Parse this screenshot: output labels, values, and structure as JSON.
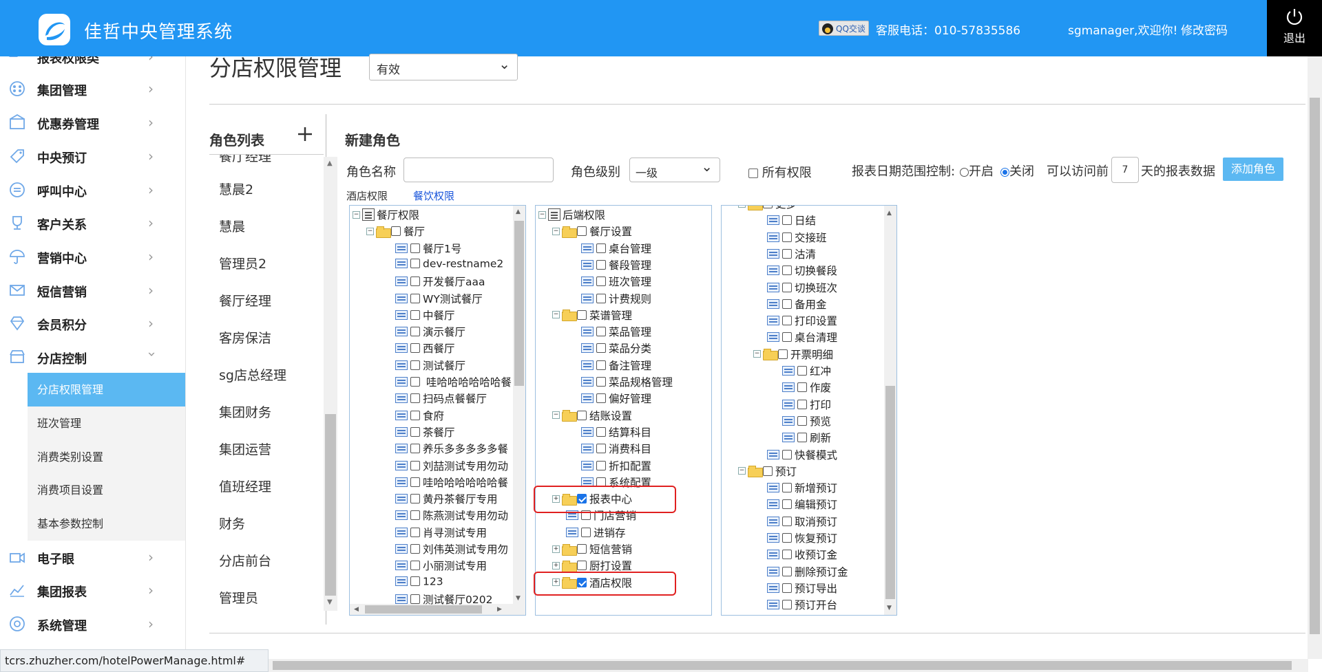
{
  "header": {
    "app_title": "佳哲中央管理系统",
    "qq_label": "QQ交谈",
    "service_phone": "客服电话：010-57835586",
    "welcome": "sgmanager,欢迎你!",
    "change_password": "修改密码",
    "logout": "退出",
    "brand_color": "#2196f3"
  },
  "sidebar": {
    "items": [
      {
        "label": "报表权限类",
        "icon": "report-icon"
      },
      {
        "label": "集团管理",
        "icon": "group-icon"
      },
      {
        "label": "优惠券管理",
        "icon": "coupon-icon"
      },
      {
        "label": "中央预订",
        "icon": "tag-icon"
      },
      {
        "label": "呼叫中心",
        "icon": "call-icon"
      },
      {
        "label": "客户关系",
        "icon": "trophy-icon"
      },
      {
        "label": "营销中心",
        "icon": "umbrella-icon"
      },
      {
        "label": "短信营销",
        "icon": "mail-icon"
      },
      {
        "label": "会员积分",
        "icon": "diamond-icon"
      },
      {
        "label": "分店控制",
        "icon": "store-icon"
      },
      {
        "label": "电子眼",
        "icon": "camera-icon"
      },
      {
        "label": "集团报表",
        "icon": "chart-icon"
      },
      {
        "label": "系统管理",
        "icon": "settings-icon"
      }
    ],
    "submenu": [
      {
        "label": "分店权限管理",
        "active": true
      },
      {
        "label": "班次管理"
      },
      {
        "label": "消费类别设置"
      },
      {
        "label": "消费项目设置"
      },
      {
        "label": "基本参数控制"
      }
    ]
  },
  "main": {
    "page_title": "分店权限管理",
    "status_value": "有效",
    "role_list_title": "角色列表",
    "roles": [
      "餐厅经理",
      "慧晨2",
      "慧晨",
      "管理员2",
      "餐厅经理",
      "客房保洁",
      "sg店总经理",
      "集团财务",
      "集团运营",
      "值班经理",
      "财务",
      "分店前台",
      "管理员"
    ],
    "new_role_title": "新建角色",
    "role_name_label": "角色名称",
    "role_name_value": "",
    "role_level_label": "角色级别",
    "role_level_value": "一级",
    "all_permissions_label": "所有权限",
    "date_range_label": "报表日期范围控制:",
    "radio_on_label": "开启",
    "radio_off_label": "关闭",
    "access_prefix": "可以访问前",
    "access_days": "7",
    "access_suffix": "天的报表数据",
    "add_role_button": "添加角色",
    "tab_hotel": "酒店权限",
    "tab_dining": "餐饮权限"
  },
  "tree1": [
    {
      "label": "餐厅权限",
      "type": "root"
    },
    {
      "label": "餐厅",
      "type": "folder"
    },
    {
      "label": "餐厅1号",
      "type": "leaf"
    },
    {
      "label": "dev-restname2",
      "type": "leaf"
    },
    {
      "label": "开发餐厅aaa",
      "type": "leaf"
    },
    {
      "label": "WY测试餐厅",
      "type": "leaf"
    },
    {
      "label": "中餐厅",
      "type": "leaf"
    },
    {
      "label": "演示餐厅",
      "type": "leaf"
    },
    {
      "label": "西餐厅",
      "type": "leaf"
    },
    {
      "label": "测试餐厅",
      "type": "leaf"
    },
    {
      "label": " 哇哈哈哈哈哈哈餐",
      "type": "leaf"
    },
    {
      "label": "扫码点餐餐厅",
      "type": "leaf"
    },
    {
      "label": "食府",
      "type": "leaf"
    },
    {
      "label": "茶餐厅",
      "type": "leaf"
    },
    {
      "label": "养乐多多多多多餐",
      "type": "leaf"
    },
    {
      "label": "刘喆测试专用勿动",
      "type": "leaf"
    },
    {
      "label": "哇哈哈哈哈哈哈餐",
      "type": "leaf"
    },
    {
      "label": "黄丹茶餐厅专用",
      "type": "leaf"
    },
    {
      "label": "陈燕测试专用勿动",
      "type": "leaf"
    },
    {
      "label": "肖寻测试专用",
      "type": "leaf"
    },
    {
      "label": "刘伟英测试专用勿",
      "type": "leaf"
    },
    {
      "label": "小丽测试专用",
      "type": "leaf"
    },
    {
      "label": "123",
      "type": "leaf"
    },
    {
      "label": "测试餐厅0202",
      "type": "leaf"
    }
  ],
  "tree2": [
    {
      "label": "后端权限",
      "type": "root"
    },
    {
      "label": "餐厅设置",
      "type": "folder"
    },
    {
      "label": "桌台管理",
      "type": "leaf"
    },
    {
      "label": "餐段管理",
      "type": "leaf"
    },
    {
      "label": "班次管理",
      "type": "leaf"
    },
    {
      "label": "计费规则",
      "type": "leaf"
    },
    {
      "label": "菜谱管理",
      "type": "folder"
    },
    {
      "label": "菜品管理",
      "type": "leaf"
    },
    {
      "label": "菜品分类",
      "type": "leaf"
    },
    {
      "label": "备注管理",
      "type": "leaf"
    },
    {
      "label": "菜品规格管理",
      "type": "leaf"
    },
    {
      "label": "偏好管理",
      "type": "leaf"
    },
    {
      "label": "结账设置",
      "type": "folder"
    },
    {
      "label": "结算科目",
      "type": "leaf"
    },
    {
      "label": "消费科目",
      "type": "leaf"
    },
    {
      "label": "折扣配置",
      "type": "leaf"
    },
    {
      "label": "系统配置",
      "type": "leaf"
    },
    {
      "label": "报表中心",
      "type": "collapsed",
      "checked": true
    },
    {
      "label": "门店营销",
      "type": "leaf"
    },
    {
      "label": "进销存",
      "type": "leaf"
    },
    {
      "label": "短信营销",
      "type": "collapsed"
    },
    {
      "label": "厨打设置",
      "type": "collapsed"
    },
    {
      "label": "酒店权限",
      "type": "collapsed",
      "checked": true
    }
  ],
  "tree3": [
    {
      "label": "更多",
      "type": "folder",
      "depth": 1
    },
    {
      "label": "日结",
      "type": "leaf",
      "depth": 2
    },
    {
      "label": "交接班",
      "type": "leaf",
      "depth": 2
    },
    {
      "label": "沽清",
      "type": "leaf",
      "depth": 2
    },
    {
      "label": "切换餐段",
      "type": "leaf",
      "depth": 2
    },
    {
      "label": "切换班次",
      "type": "leaf",
      "depth": 2
    },
    {
      "label": "备用金",
      "type": "leaf",
      "depth": 2
    },
    {
      "label": "打印设置",
      "type": "leaf",
      "depth": 2
    },
    {
      "label": "桌台清理",
      "type": "leaf",
      "depth": 2
    },
    {
      "label": "开票明细",
      "type": "folder",
      "depth": 2
    },
    {
      "label": "红冲",
      "type": "leaf",
      "depth": 3
    },
    {
      "label": "作废",
      "type": "leaf",
      "depth": 3
    },
    {
      "label": "打印",
      "type": "leaf",
      "depth": 3
    },
    {
      "label": "预览",
      "type": "leaf",
      "depth": 3
    },
    {
      "label": "刷新",
      "type": "leaf",
      "depth": 3
    },
    {
      "label": "快餐模式",
      "type": "leaf",
      "depth": 2
    },
    {
      "label": "预订",
      "type": "folder",
      "depth": 1
    },
    {
      "label": "新增预订",
      "type": "leaf",
      "depth": 2
    },
    {
      "label": "编辑预订",
      "type": "leaf",
      "depth": 2
    },
    {
      "label": "取消预订",
      "type": "leaf",
      "depth": 2
    },
    {
      "label": "恢复预订",
      "type": "leaf",
      "depth": 2
    },
    {
      "label": "收预订金",
      "type": "leaf",
      "depth": 2
    },
    {
      "label": "删除预订金",
      "type": "leaf",
      "depth": 2
    },
    {
      "label": "预订导出",
      "type": "leaf",
      "depth": 2
    },
    {
      "label": "预订开台",
      "type": "leaf",
      "depth": 2
    }
  ],
  "statusbar": {
    "url": "tcrs.zhuzher.com/hotelPowerManage.html#"
  }
}
